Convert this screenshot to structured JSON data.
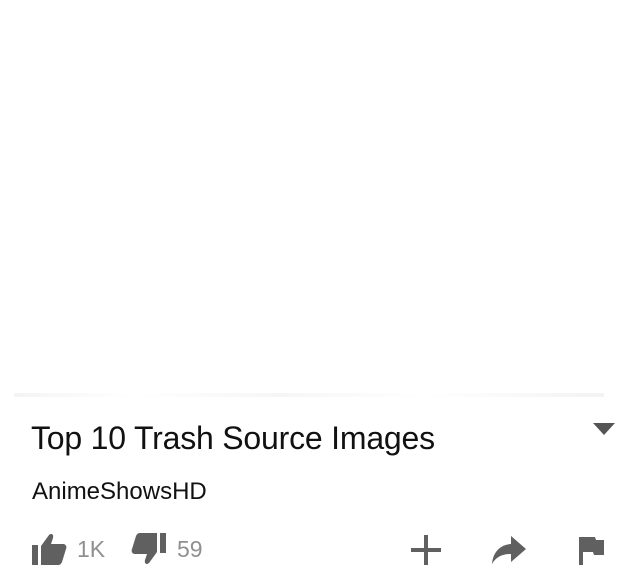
{
  "video": {
    "title": "Top 10 Trash Source Images",
    "channel": "AnimeShowsHD"
  },
  "actions": {
    "like_count": "1K",
    "dislike_count": "59",
    "like_icon": "thumbs-up-icon",
    "dislike_icon": "thumbs-down-icon",
    "add_icon": "plus-icon",
    "share_icon": "share-arrow-icon",
    "flag_icon": "flag-icon",
    "expand_icon": "chevron-down-icon"
  },
  "colors": {
    "text": "#111111",
    "muted": "#909090",
    "icon": "#606060"
  }
}
